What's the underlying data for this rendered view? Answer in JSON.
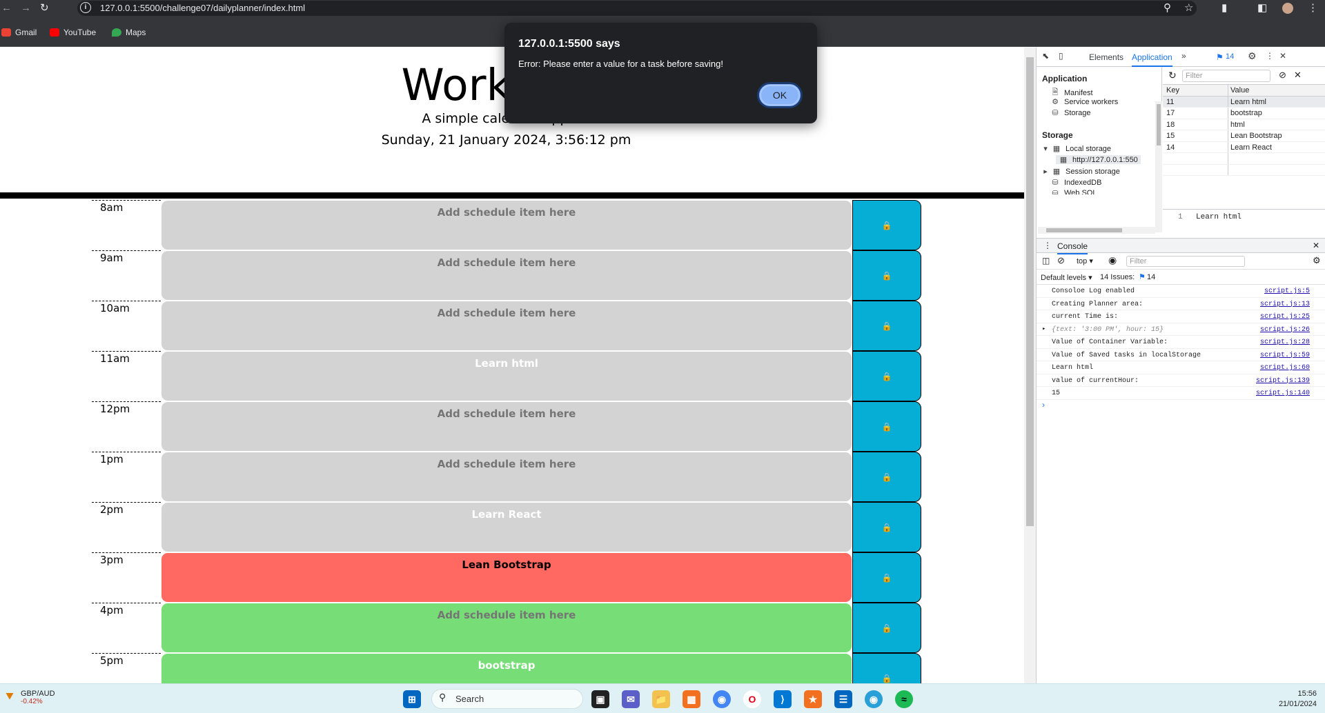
{
  "browser": {
    "url": "127.0.0.1:5500/challenge07/dailyplanner/index.html",
    "bookmarks": [
      {
        "label": "Gmail",
        "color": "#ea4335"
      },
      {
        "label": "YouTube",
        "color": "#ff0000"
      },
      {
        "label": "Maps",
        "color": "#34a853"
      }
    ]
  },
  "page": {
    "title": "Work Day",
    "subtitle": "A simple calendar app for",
    "datetime": "Sunday, 21 January 2024, 3:56:12 pm",
    "save_icon": "lock-icon",
    "rows": [
      {
        "hour": "8am",
        "text": "Add schedule item here",
        "state": "past",
        "filled": false
      },
      {
        "hour": "9am",
        "text": "Add schedule item here",
        "state": "past",
        "filled": false
      },
      {
        "hour": "10am",
        "text": "Add schedule item here",
        "state": "past",
        "filled": false
      },
      {
        "hour": "11am",
        "text": "Learn html",
        "state": "past",
        "filled": true
      },
      {
        "hour": "12pm",
        "text": "Add schedule item here",
        "state": "past",
        "filled": false
      },
      {
        "hour": "1pm",
        "text": "Add schedule item here",
        "state": "past",
        "filled": false
      },
      {
        "hour": "2pm",
        "text": "Learn React",
        "state": "past",
        "filled": true
      },
      {
        "hour": "3pm",
        "text": "Lean Bootstrap",
        "state": "present",
        "filled": true
      },
      {
        "hour": "4pm",
        "text": "Add schedule item here",
        "state": "future",
        "filled": false
      },
      {
        "hour": "5pm",
        "text": "bootstrap",
        "state": "future",
        "filled": true
      }
    ]
  },
  "alert": {
    "title": "127.0.0.1:5500 says",
    "message": "Error: Please enter a value for a task before saving!",
    "ok_label": "OK"
  },
  "devtools": {
    "tabs": {
      "elements": "Elements",
      "application": "Application",
      "issues_count": "14"
    },
    "side": {
      "app_heading": "Application",
      "app_items": [
        "Manifest",
        "Service workers",
        "Storage"
      ],
      "storage_heading": "Storage",
      "local_storage": "Local storage",
      "origin": "http://127.0.0.1:550",
      "session_storage": "Session storage",
      "indexeddb": "IndexedDB",
      "websql": "Web SQL"
    },
    "storage_filter": "Filter",
    "table_headers": {
      "key": "Key",
      "value": "Value"
    },
    "storage_rows": [
      {
        "key": "11",
        "value": "Learn html"
      },
      {
        "key": "17",
        "value": "bootstrap"
      },
      {
        "key": "18",
        "value": "html"
      },
      {
        "key": "15",
        "value": "Lean Bootstrap"
      },
      {
        "key": "14",
        "value": "Learn React"
      }
    ],
    "preview": {
      "line": "1",
      "text": "Learn html"
    },
    "console": {
      "tab": "Console",
      "context": "top",
      "filter": "Filter",
      "levels": "Default levels",
      "issues": "14 Issues:",
      "issues_count": "14",
      "lines": [
        {
          "msg": "Consoloe Log enabled",
          "src": "script.js:5"
        },
        {
          "msg": "Creating Planner area:",
          "src": "script.js:13"
        },
        {
          "msg": "current Time is:",
          "src": "script.js:25"
        },
        {
          "msg": "{text: '3:00 PM', hour: 15}",
          "src": "script.js:26",
          "object": true
        },
        {
          "msg": "Value of Container Variable:",
          "src": "script.js:28"
        },
        {
          "msg": "Value of Saved tasks in localStorage",
          "src": "script.js:59"
        },
        {
          "msg": "Learn html",
          "src": "script.js:60"
        },
        {
          "msg": "value of currentHour:",
          "src": "script.js:139"
        },
        {
          "msg": "15",
          "src": "script.js:140"
        }
      ]
    }
  },
  "taskbar": {
    "ticker_name": "GBP/AUD",
    "ticker_value": "-0.42%",
    "search": "Search",
    "time": "15:56",
    "date": "21/01/2024"
  }
}
